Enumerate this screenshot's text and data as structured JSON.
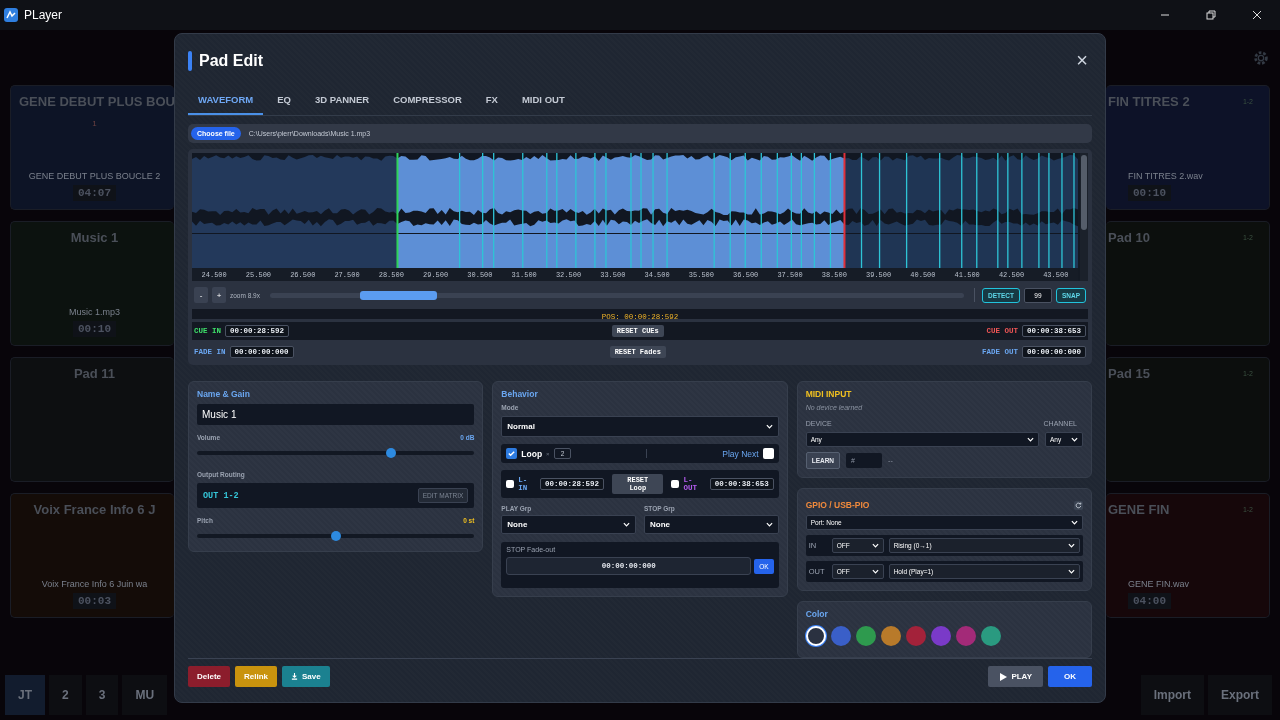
{
  "window": {
    "title": "PLayer"
  },
  "pads_left": [
    {
      "title": "GENE DEBUT PLUS BOU",
      "badge": "1",
      "file": "GENE DEBUT PLUS BOUCLE 2",
      "time": "04:07",
      "color": "#0d1426"
    },
    {
      "title": "Music 1",
      "file": "Music 1.mp3",
      "time": "00:10",
      "color": "#0c120f"
    },
    {
      "title": "Pad 11",
      "color": "#0d0f11"
    },
    {
      "title": "Voix France Info 6 J",
      "file": "Voix France Info 6 Juin wa",
      "time": "00:03",
      "color": "#140c08"
    }
  ],
  "pads_right": [
    {
      "title": "FIN TITRES 2",
      "routing": "1-2",
      "file": "FIN TITRES 2.wav",
      "time": "00:10",
      "color": "#0d1228"
    },
    {
      "title": "Pad 10",
      "routing": "1-2",
      "color": "#0c0f0d"
    },
    {
      "title": "Pad 15",
      "routing": "1-2",
      "color": "#0c0e0d"
    },
    {
      "title": "GENE FIN",
      "routing": "1-2",
      "file": "GENE FIN.wav",
      "time": "04:00",
      "color": "#16070a"
    }
  ],
  "bottom_tabs": [
    {
      "label": "JT",
      "selected": true
    },
    {
      "label": "2",
      "selected": false
    },
    {
      "label": "3",
      "selected": false
    },
    {
      "label": "MU",
      "selected": false
    }
  ],
  "bottom_buttons": [
    "Import",
    "Export"
  ],
  "dialog": {
    "title": "Pad Edit",
    "close": "×",
    "tabs": [
      {
        "label": "WAVEFORM",
        "selected": true
      },
      {
        "label": "EQ",
        "selected": false
      },
      {
        "label": "3D PANNER",
        "selected": false
      },
      {
        "label": "COMPRESSOR",
        "selected": false
      },
      {
        "label": "FX",
        "selected": false
      },
      {
        "label": "MIDI OUT",
        "selected": false
      }
    ],
    "file": {
      "button": "Choose file",
      "path": "C:\\Users\\pierr\\Downloads\\Music 1.mp3"
    },
    "waveform": {
      "ticks": [
        "24.500",
        "25.500",
        "26.500",
        "27.500",
        "28.500",
        "29.500",
        "30.500",
        "31.500",
        "32.500",
        "33.500",
        "34.500",
        "35.500",
        "36.500",
        "37.500",
        "38.500",
        "39.500",
        "40.500",
        "41.500",
        "42.500",
        "43.500"
      ],
      "zoom_out": "-",
      "zoom_in": "+",
      "zoom": "zoom 8.9x",
      "detect": "DETECT",
      "sensitivity": "99",
      "snap": "SNAP",
      "position": "POS: 00:00:28:592",
      "cue_in": {
        "label": "CUE IN",
        "value": "00:00:28:592"
      },
      "reset_cues": "RESET CUEs",
      "cue_out": {
        "label": "CUE OUT",
        "value": "00:00:38:653"
      },
      "fade_in": {
        "label": "FADE IN",
        "value": "00:00:00:000"
      },
      "reset_fades": "RESET Fades",
      "fade_out": {
        "label": "FADE OUT",
        "value": "00:00:00:000"
      }
    },
    "name_gain": {
      "title": "Name & Gain",
      "name": "Music 1",
      "volume": {
        "label": "Volume",
        "reading": "0 dB",
        "level": 0.7
      },
      "routing": {
        "label": "Output Routing",
        "value": "OUT 1-2",
        "button": "EDIT MATRIX"
      },
      "pitch": {
        "label": "Pitch",
        "reading": "0 st",
        "level": 0.5
      }
    },
    "behavior": {
      "title": "Behavior",
      "mode_label": "Mode",
      "mode": "Normal",
      "loop": {
        "label": "Loop",
        "checked": true,
        "times": "×",
        "count": "2"
      },
      "play_next": {
        "label": "Play Next",
        "checked": false
      },
      "loop_in": {
        "label": "L-IN",
        "checked": false,
        "value": "00:00:28:592"
      },
      "reset_loop": "RESET Loop",
      "loop_out": {
        "label": "L-OUT",
        "checked": false,
        "value": "00:00:38:653"
      },
      "play_group": {
        "label": "PLAY Grp",
        "value": "None"
      },
      "stop_group": {
        "label": "STOP Grp",
        "value": "None"
      },
      "stop_fade": {
        "label": "STOP Fade-out",
        "value": "00:00:00:000",
        "button": "OK"
      }
    },
    "midi": {
      "title": "MIDI INPUT",
      "status": "No device learned",
      "device_label": "DEVICE",
      "channel_label": "CHANNEL",
      "device": "Any",
      "channel": "Any",
      "learn": "LEARN",
      "note_placeholder": "#",
      "note_value": "--"
    },
    "gpio": {
      "title": "GPIO / USB-PIO",
      "port": "Port: None",
      "rows": [
        {
          "label": "IN",
          "state": "OFF",
          "mode": "Rising (0→1)"
        },
        {
          "label": "OUT",
          "state": "OFF",
          "mode": "Hold (Play=1)"
        }
      ]
    },
    "color": {
      "title": "Color",
      "swatches": [
        {
          "color": "#2a3140",
          "selected": true
        },
        {
          "color": "#3a5fc8",
          "selected": false
        },
        {
          "color": "#2e9a4e",
          "selected": false
        },
        {
          "color": "#b87a2a",
          "selected": false
        },
        {
          "color": "#a3223a",
          "selected": false
        },
        {
          "color": "#7a3ac8",
          "selected": false
        },
        {
          "color": "#a32a78",
          "selected": false
        },
        {
          "color": "#2a9a80",
          "selected": false
        }
      ]
    },
    "footer": {
      "delete": "Delete",
      "relink": "Relink",
      "save": "Save",
      "play": "PLAY",
      "ok": "OK"
    }
  }
}
